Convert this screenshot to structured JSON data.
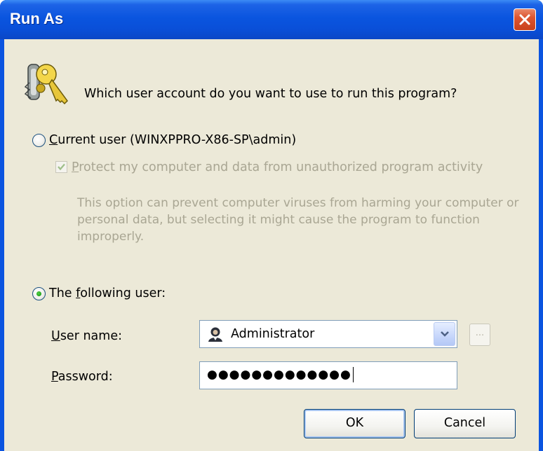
{
  "window": {
    "title": "Run As"
  },
  "prompt": {
    "question": "Which user account do you want to use to run this program?"
  },
  "current_user": {
    "label_accel": "C",
    "label_rest": "urrent user (WINXPPRO-X86-SP\\admin)",
    "selected": false,
    "protect": {
      "label_accel": "P",
      "label_rest": "rotect my computer and data from unauthorized program activity",
      "checked": true,
      "enabled": false
    },
    "description": "This option can prevent computer viruses from harming your computer or personal data, but selecting it might cause the program to function improperly."
  },
  "following_user": {
    "label_pre": "The ",
    "label_accel": "f",
    "label_post": "ollowing user:",
    "selected": true,
    "username": {
      "label_accel": "U",
      "label_rest": "ser name:",
      "value": "Administrator"
    },
    "browse_label": "...",
    "password": {
      "label_accel": "P",
      "label_rest": "assword:",
      "masked_value": "●●●●●●●●●●●●●"
    }
  },
  "buttons": {
    "ok": "OK",
    "cancel": "Cancel"
  },
  "colors": {
    "titlebar": "#0a55df",
    "dialog_bg": "#ece9d8",
    "close_button": "#dd5530",
    "disabled_text": "#a9a693"
  },
  "icons": {
    "title_close": "close-icon",
    "header": "keys-icon",
    "user": "user-icon",
    "dropdown": "chevron-down-icon"
  }
}
